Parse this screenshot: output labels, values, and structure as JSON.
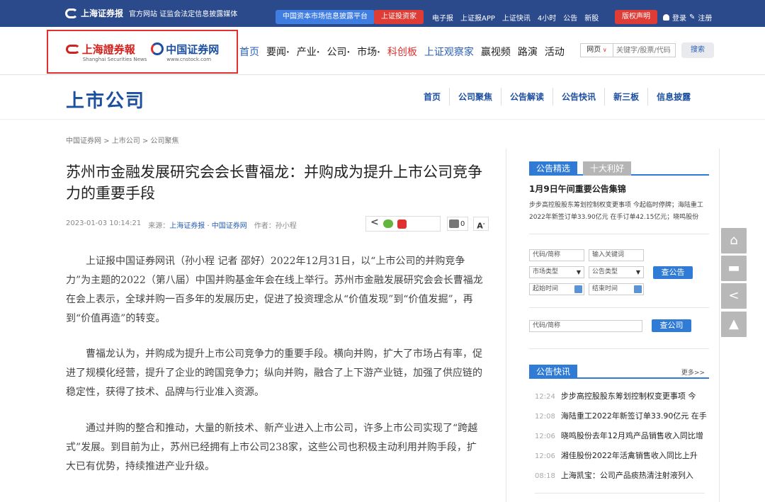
{
  "topbar": {
    "brand_name": "上海证券报",
    "brand_sub": "官方网站 证监会法定信息披露媒体",
    "pill_blue": "中国资本市场信息披露平台",
    "pill_red": "上证投资家",
    "links": [
      "电子报",
      "上证报APP",
      "上证快讯",
      "4小时",
      "公告",
      "新股"
    ],
    "pill_red2": "版权声明",
    "login": "登录",
    "register": "注册"
  },
  "header": {
    "logo1_cn": "上海證券報",
    "logo1_en": "Shanghai Securities News",
    "logo2_cn": "中国证券网",
    "logo2_en": "www.cnstock.com",
    "nav": [
      "首页",
      "要闻",
      "产业",
      "公司",
      "市场",
      "科创板",
      "上证观察家",
      "赢视频",
      "路演",
      "活动"
    ],
    "search_type": "网页",
    "search_placeholder": "关键字/股票/代码",
    "search_button": "搜索"
  },
  "section": {
    "title": "上市公司",
    "subnav": [
      "首页",
      "公司聚焦",
      "公告解读",
      "公告快讯",
      "新三板",
      "信息披露"
    ]
  },
  "breadcrumb": "中国证券网 > 上市公司 > 公司聚焦",
  "article": {
    "title": "苏州市金融发展研究会会长曹福龙：并购成为提升上市公司竞争力的重要手段",
    "datetime": "2023-01-03 10:14:21",
    "source_label": "来源：",
    "source": "上海证券报 · 中国证券网",
    "author": "作者：孙小程",
    "comment_count": "0",
    "font_button": "A",
    "paragraphs": [
      "上证报中国证券网讯（孙小程 记者 邵好）2022年12月31日，以“上市公司的并购竞争力”为主题的2022（第八届）中国并购基金年会在线上举行。苏州市金融发展研究会会长曹福龙在会上表示，全球并购一百多年的发展历史，促进了投资理念从“价值发现”到“价值发掘”，再到“价值再造”的转变。",
      "曹福龙认为，并购成为提升上市公司竞争力的重要手段。横向并购，扩大了市场占有率，促进了规模化经营，提升了企业的跨国竞争力；纵向并购，融合了上下游产业链，加强了供应链的稳定性，获得了技术、品牌与行业准入资源。",
      "通过并购的整合和推动，大量的新技术、新产业进入上市公司，许多上市公司实现了“跨越式”发展。到目前为止，苏州已经拥有上市公司238家，这些公司也积极主动利用并购手段，扩大已有优势，持续推进产业升级。"
    ]
  },
  "sidebar": {
    "tab_active": "公告精选",
    "tab_inactive": "十大利好",
    "heading": "1月9日午间重要公告集锦",
    "summary": "步步高控股股东筹划控制权变更事项 今起临时停牌；海陆重工2022年新签订单33.90亿元 在手订单42.15亿元；晓鸣股份",
    "field_code": "代码/简称",
    "field_keyword": "输入关键词",
    "field_market": "市场类型",
    "field_notice_type": "公告类型",
    "query_button": "查公告",
    "field_start": "起始时间",
    "field_end": "结束时间",
    "field_code2": "代码/简称",
    "query_button2": "查公司",
    "quick_tab": "公告快讯",
    "more": "更多>>",
    "news": [
      {
        "time": "12:24",
        "text": "步步高控股股东筹划控制权变更事项 今"
      },
      {
        "time": "12:08",
        "text": "海陆重工2022年新签订单33.90亿元 在手"
      },
      {
        "time": "12:06",
        "text": "晓鸣股份去年12月鸡产品销售收入同比增"
      },
      {
        "time": "12:06",
        "text": "湘佳股份2022年活禽销售收入同比上升"
      },
      {
        "time": "08:18",
        "text": "上海凯宝：公司产品痰热清注射液列入"
      }
    ]
  },
  "icons": {
    "float": [
      "home-icon",
      "comment-icon",
      "share-icon",
      "back-to-top-icon"
    ]
  }
}
